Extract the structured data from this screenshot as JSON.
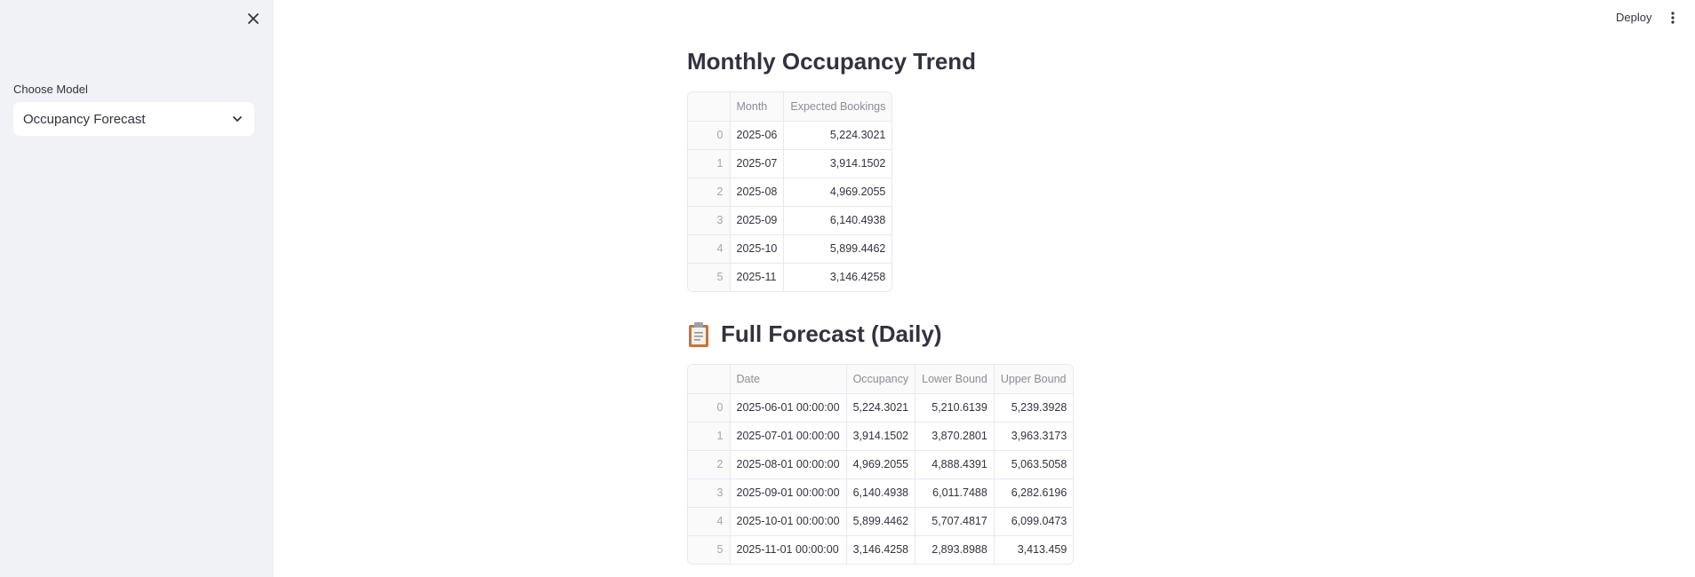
{
  "sidebar": {
    "select_label": "Choose Model",
    "select_value": "Occupancy Forecast"
  },
  "header": {
    "deploy_label": "Deploy"
  },
  "monthly": {
    "title": "Monthly Occupancy Trend",
    "columns": [
      "Month",
      "Expected Bookings"
    ],
    "rows": [
      {
        "idx": "0",
        "month": "2025-06",
        "expected": "5,224.3021"
      },
      {
        "idx": "1",
        "month": "2025-07",
        "expected": "3,914.1502"
      },
      {
        "idx": "2",
        "month": "2025-08",
        "expected": "4,969.2055"
      },
      {
        "idx": "3",
        "month": "2025-09",
        "expected": "6,140.4938"
      },
      {
        "idx": "4",
        "month": "2025-10",
        "expected": "5,899.4462"
      },
      {
        "idx": "5",
        "month": "2025-11",
        "expected": "3,146.4258"
      }
    ]
  },
  "daily": {
    "title": "Full Forecast (Daily)",
    "icon": "clipboard-icon",
    "columns": [
      "Date",
      "Occupancy",
      "Lower Bound",
      "Upper Bound"
    ],
    "rows": [
      {
        "idx": "0",
        "date": "2025-06-01 00:00:00",
        "occupancy": "5,224.3021",
        "lower": "5,210.6139",
        "upper": "5,239.3928"
      },
      {
        "idx": "1",
        "date": "2025-07-01 00:00:00",
        "occupancy": "3,914.1502",
        "lower": "3,870.2801",
        "upper": "3,963.3173"
      },
      {
        "idx": "2",
        "date": "2025-08-01 00:00:00",
        "occupancy": "4,969.2055",
        "lower": "4,888.4391",
        "upper": "5,063.5058"
      },
      {
        "idx": "3",
        "date": "2025-09-01 00:00:00",
        "occupancy": "6,140.4938",
        "lower": "6,011.7488",
        "upper": "6,282.6196"
      },
      {
        "idx": "4",
        "date": "2025-10-01 00:00:00",
        "occupancy": "5,899.4462",
        "lower": "5,707.4817",
        "upper": "6,099.0473"
      },
      {
        "idx": "5",
        "date": "2025-11-01 00:00:00",
        "occupancy": "3,146.4258",
        "lower": "2,893.8988",
        "upper": "3,413.459"
      }
    ]
  }
}
